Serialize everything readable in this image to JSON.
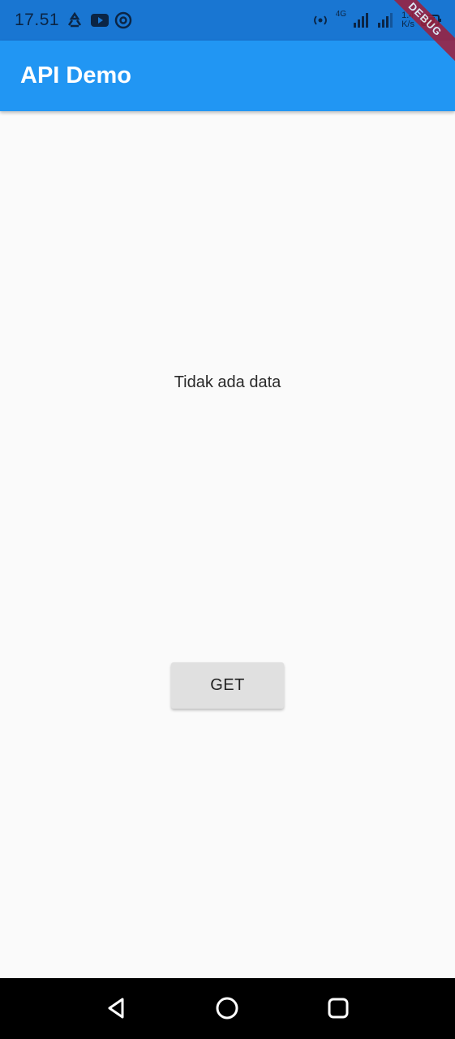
{
  "status_bar": {
    "time": "17.51",
    "network_label": "4G",
    "speed_value": "1.4",
    "speed_unit": "K/s",
    "icons": [
      "recycle-icon",
      "youtube-icon",
      "at-icon",
      "hotspot-icon",
      "signal-icon",
      "signal-icon",
      "battery-icon"
    ]
  },
  "app_bar": {
    "title": "API Demo",
    "color": "#2196f3"
  },
  "debug_banner": "DEBUG",
  "main": {
    "message": "Tidak ada data",
    "button_label": "GET"
  },
  "nav_bar": {
    "buttons": [
      "back-icon",
      "home-icon",
      "recents-icon"
    ]
  }
}
